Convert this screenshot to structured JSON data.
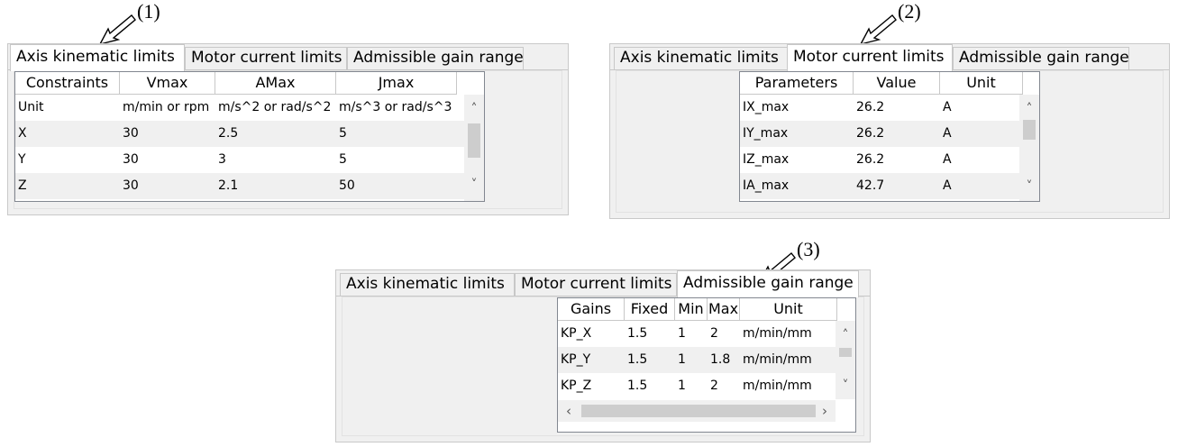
{
  "annotations": [
    "(1)",
    "(2)",
    "(3)"
  ],
  "tabs": [
    "Axis kinematic limits",
    "Motor current limits",
    "Admissible gain range"
  ],
  "panel1": {
    "active_tab": 0,
    "columns": [
      "Constraints",
      "Vmax",
      "AMax",
      "Jmax"
    ],
    "rows": [
      [
        "Unit",
        "m/min or rpm",
        "m/s^2 or rad/s^2",
        "m/s^3 or rad/s^3"
      ],
      [
        "X",
        "30",
        "2.5",
        "5"
      ],
      [
        "Y",
        "30",
        "3",
        "5"
      ],
      [
        "Z",
        "30",
        "2.1",
        "50"
      ]
    ]
  },
  "panel2": {
    "active_tab": 1,
    "columns": [
      "Parameters",
      "Value",
      "Unit"
    ],
    "rows": [
      [
        "IX_max",
        "26.2",
        "A"
      ],
      [
        "IY_max",
        "26.2",
        "A"
      ],
      [
        "IZ_max",
        "26.2",
        "A"
      ],
      [
        "IA_max",
        "42.7",
        "A"
      ]
    ]
  },
  "panel3": {
    "active_tab": 2,
    "columns": [
      "Gains",
      "Fixed",
      "Min",
      "Max",
      "Unit"
    ],
    "rows": [
      [
        "KP_X",
        "1.5",
        "1",
        "2",
        "m/min/mm"
      ],
      [
        "KP_Y",
        "1.5",
        "1",
        "1.8",
        "m/min/mm"
      ],
      [
        "KP_Z",
        "1.5",
        "1",
        "2",
        "m/min/mm"
      ]
    ]
  },
  "scroll_icons": {
    "up": "chevron-up-icon",
    "down": "chevron-down-icon",
    "left": "chevron-left-icon",
    "right": "chevron-right-icon"
  }
}
